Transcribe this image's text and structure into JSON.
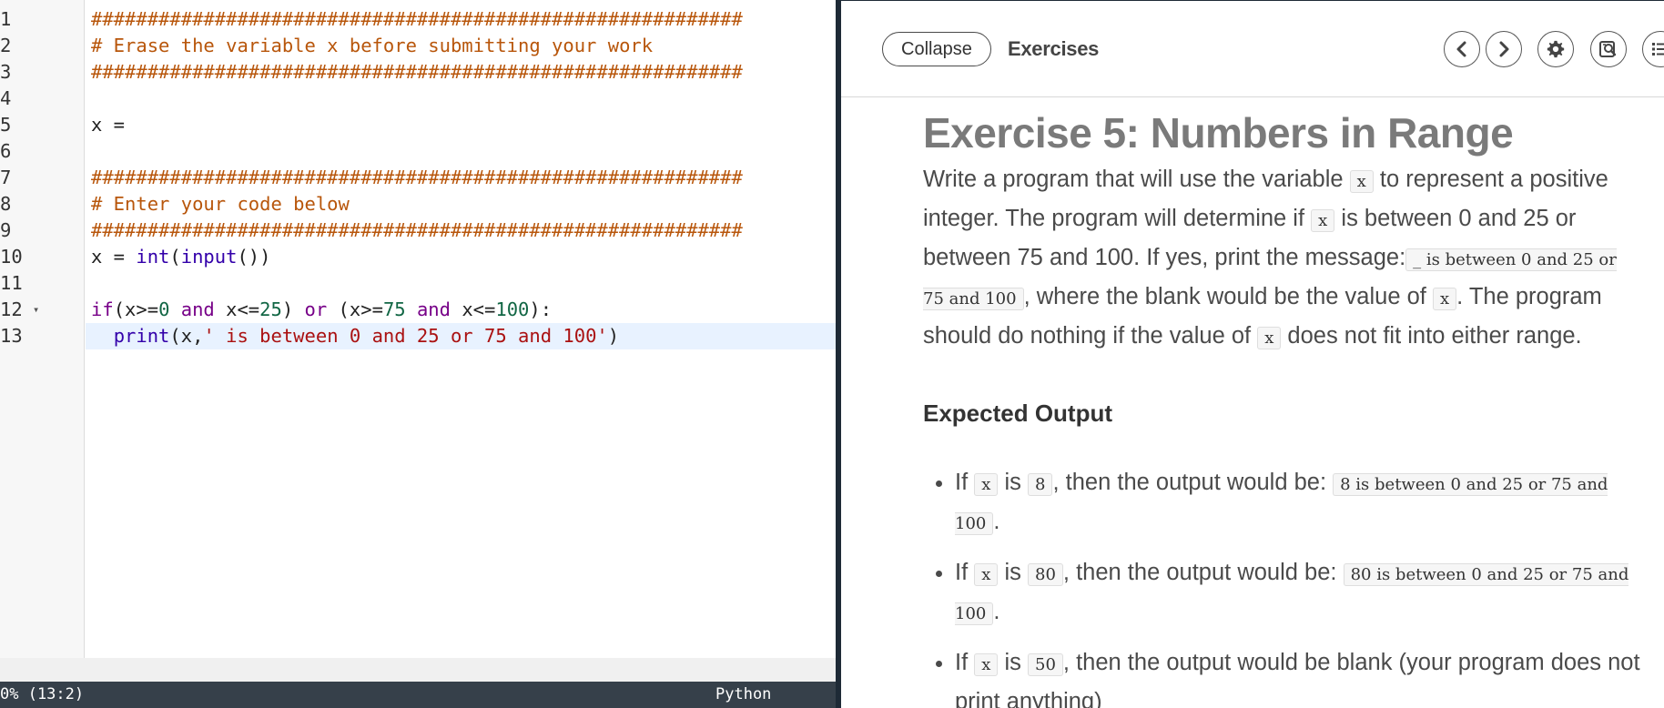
{
  "editor": {
    "lines": [
      {
        "num": "1",
        "fold": "",
        "tokens": [
          {
            "t": "##########################################################",
            "c": "comment"
          }
        ]
      },
      {
        "num": "2",
        "fold": "",
        "tokens": [
          {
            "t": "# Erase the variable x before submitting your work",
            "c": "comment"
          }
        ]
      },
      {
        "num": "3",
        "fold": "",
        "tokens": [
          {
            "t": "##########################################################",
            "c": "comment"
          }
        ]
      },
      {
        "num": "4",
        "fold": "",
        "tokens": []
      },
      {
        "num": "5",
        "fold": "",
        "tokens": [
          {
            "t": "x = ",
            "c": "plain"
          }
        ]
      },
      {
        "num": "6",
        "fold": "",
        "tokens": []
      },
      {
        "num": "7",
        "fold": "",
        "tokens": [
          {
            "t": "##########################################################",
            "c": "comment"
          }
        ]
      },
      {
        "num": "8",
        "fold": "",
        "tokens": [
          {
            "t": "# Enter your code below",
            "c": "comment"
          }
        ]
      },
      {
        "num": "9",
        "fold": "",
        "tokens": [
          {
            "t": "##########################################################",
            "c": "comment"
          }
        ]
      },
      {
        "num": "10",
        "fold": "",
        "tokens": [
          {
            "t": "x = ",
            "c": "plain"
          },
          {
            "t": "int",
            "c": "builtin"
          },
          {
            "t": "(",
            "c": "plain"
          },
          {
            "t": "input",
            "c": "builtin"
          },
          {
            "t": "())",
            "c": "plain"
          }
        ]
      },
      {
        "num": "11",
        "fold": "",
        "tokens": []
      },
      {
        "num": "12",
        "fold": "▾",
        "tokens": [
          {
            "t": "if",
            "c": "kw"
          },
          {
            "t": "(x>=",
            "c": "plain"
          },
          {
            "t": "0",
            "c": "num"
          },
          {
            "t": " ",
            "c": "plain"
          },
          {
            "t": "and",
            "c": "kw"
          },
          {
            "t": " x<=",
            "c": "plain"
          },
          {
            "t": "25",
            "c": "num"
          },
          {
            "t": ") ",
            "c": "plain"
          },
          {
            "t": "or",
            "c": "kw"
          },
          {
            "t": " (x>=",
            "c": "plain"
          },
          {
            "t": "75",
            "c": "num"
          },
          {
            "t": " ",
            "c": "plain"
          },
          {
            "t": "and",
            "c": "kw"
          },
          {
            "t": " x<=",
            "c": "plain"
          },
          {
            "t": "100",
            "c": "num"
          },
          {
            "t": "):",
            "c": "plain"
          }
        ]
      },
      {
        "num": "13",
        "fold": "",
        "active": true,
        "tokens": [
          {
            "t": "  ",
            "c": "plain"
          },
          {
            "t": "print",
            "c": "builtin"
          },
          {
            "t": "(x,",
            "c": "plain"
          },
          {
            "t": "' is between 0 and 25 or 75 and 100'",
            "c": "str"
          },
          {
            "t": ")",
            "c": "plain"
          }
        ]
      }
    ],
    "status": {
      "position": "0% (13:2)",
      "language": "Python"
    }
  },
  "guide": {
    "collapse_label": "Collapse",
    "title": "Exercises",
    "buttons": [
      "chevron-left-icon",
      "chevron-right-icon",
      "gear-icon",
      "search-book-icon",
      "list-icon"
    ],
    "exercise": {
      "title": "Exercise 5: Numbers in Range",
      "intro_1": "Write a program that will use the variable ",
      "var_x": "x",
      "intro_2": " to represent a positive integer. The program will determine if ",
      "intro_3": " is between 0 and 25 or between 75 and 100. If yes, print the message:",
      "message": "_ is between 0 and 25 or 75 and 100",
      "intro_4": ", where the blank would be the value of ",
      "intro_5": ". The program should do nothing if the value of ",
      "intro_6": " does not fit into either range.",
      "expected_heading": "Expected Output",
      "bullets": [
        {
          "pre": "If ",
          "var": "x",
          "mid": " is ",
          "val": "8",
          "post": ", then the output would be: ",
          "out": "8 is between 0 and 25 or 75 and 100",
          "end": "."
        },
        {
          "pre": "If ",
          "var": "x",
          "mid": " is ",
          "val": "80",
          "post": ", then the output would be: ",
          "out": "80 is between 0 and 25 or 75 and 100",
          "end": "."
        },
        {
          "pre": "If ",
          "var": "x",
          "mid": " is ",
          "val": "50",
          "post": ", then the output would be blank (your program does not print anything)",
          "out": "",
          "end": ""
        }
      ]
    }
  }
}
